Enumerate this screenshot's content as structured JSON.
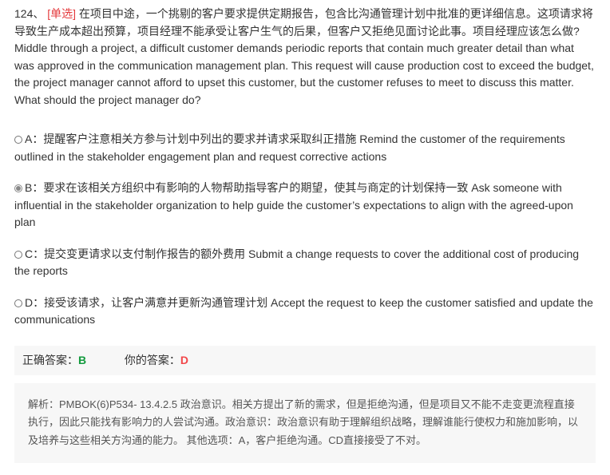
{
  "question": {
    "number": "124、",
    "type_tag": "[单选]",
    "text_cn": "在项目中途，一个挑剔的客户要求提供定期报告，包含比沟通管理计划中批准的更详细信息。这项请求将导致生产成本超出预算，项目经理不能承受让客户生气的后果，但客户又拒绝见面讨论此事。项目经理应该怎么做?",
    "text_en": "Middle through a project, a difficult customer demands periodic reports that contain much greater detail than what was approved in the communication management plan. This request will cause production cost to exceed the budget, the project manager cannot afford to upset this customer, but the customer refuses to meet to discuss this matter. What should the project manager do?"
  },
  "options": [
    {
      "label": "A：提醒客户注意相关方参与计划中列出的要求并请求采取纠正措施 Remind the customer of the requirements outlined in the stakeholder engagement plan and request corrective actions",
      "selected": false
    },
    {
      "label": "B：要求在该相关方组织中有影响的人物帮助指导客户的期望，使其与商定的计划保持一致 Ask someone with influential in the stakeholder organization to help guide the customer’s expectations to align with the agreed-upon plan",
      "selected": true
    },
    {
      "label": "C：提交变更请求以支付制作报告的额外费用 Submit a change requests to cover the additional cost of producing the reports",
      "selected": false
    },
    {
      "label": "D：接受该请求，让客户满意并更新沟通管理计划 Accept the request to keep the customer satisfied and update the communications",
      "selected": false
    }
  ],
  "answer": {
    "correct_label": "正确答案：",
    "correct_value": "B",
    "yours_label": "你的答案：",
    "yours_value": "D",
    "correct_color": "#129a3d",
    "wrong_color": "#f2474a"
  },
  "explanation": "解析：PMBOK(6)P534- 13.4.2.5 政治意识。相关方提出了新的需求，但是拒绝沟通，但是项目又不能不走变更流程直接执行，因此只能找有影响力的人尝试沟通。政治意识：政治意识有助于理解组织战略，理解谁能行使权力和施加影响，以及培养与这些相关方沟通的能力。 其他选项：A，客户拒绝沟通。CD直接接受了不对。"
}
